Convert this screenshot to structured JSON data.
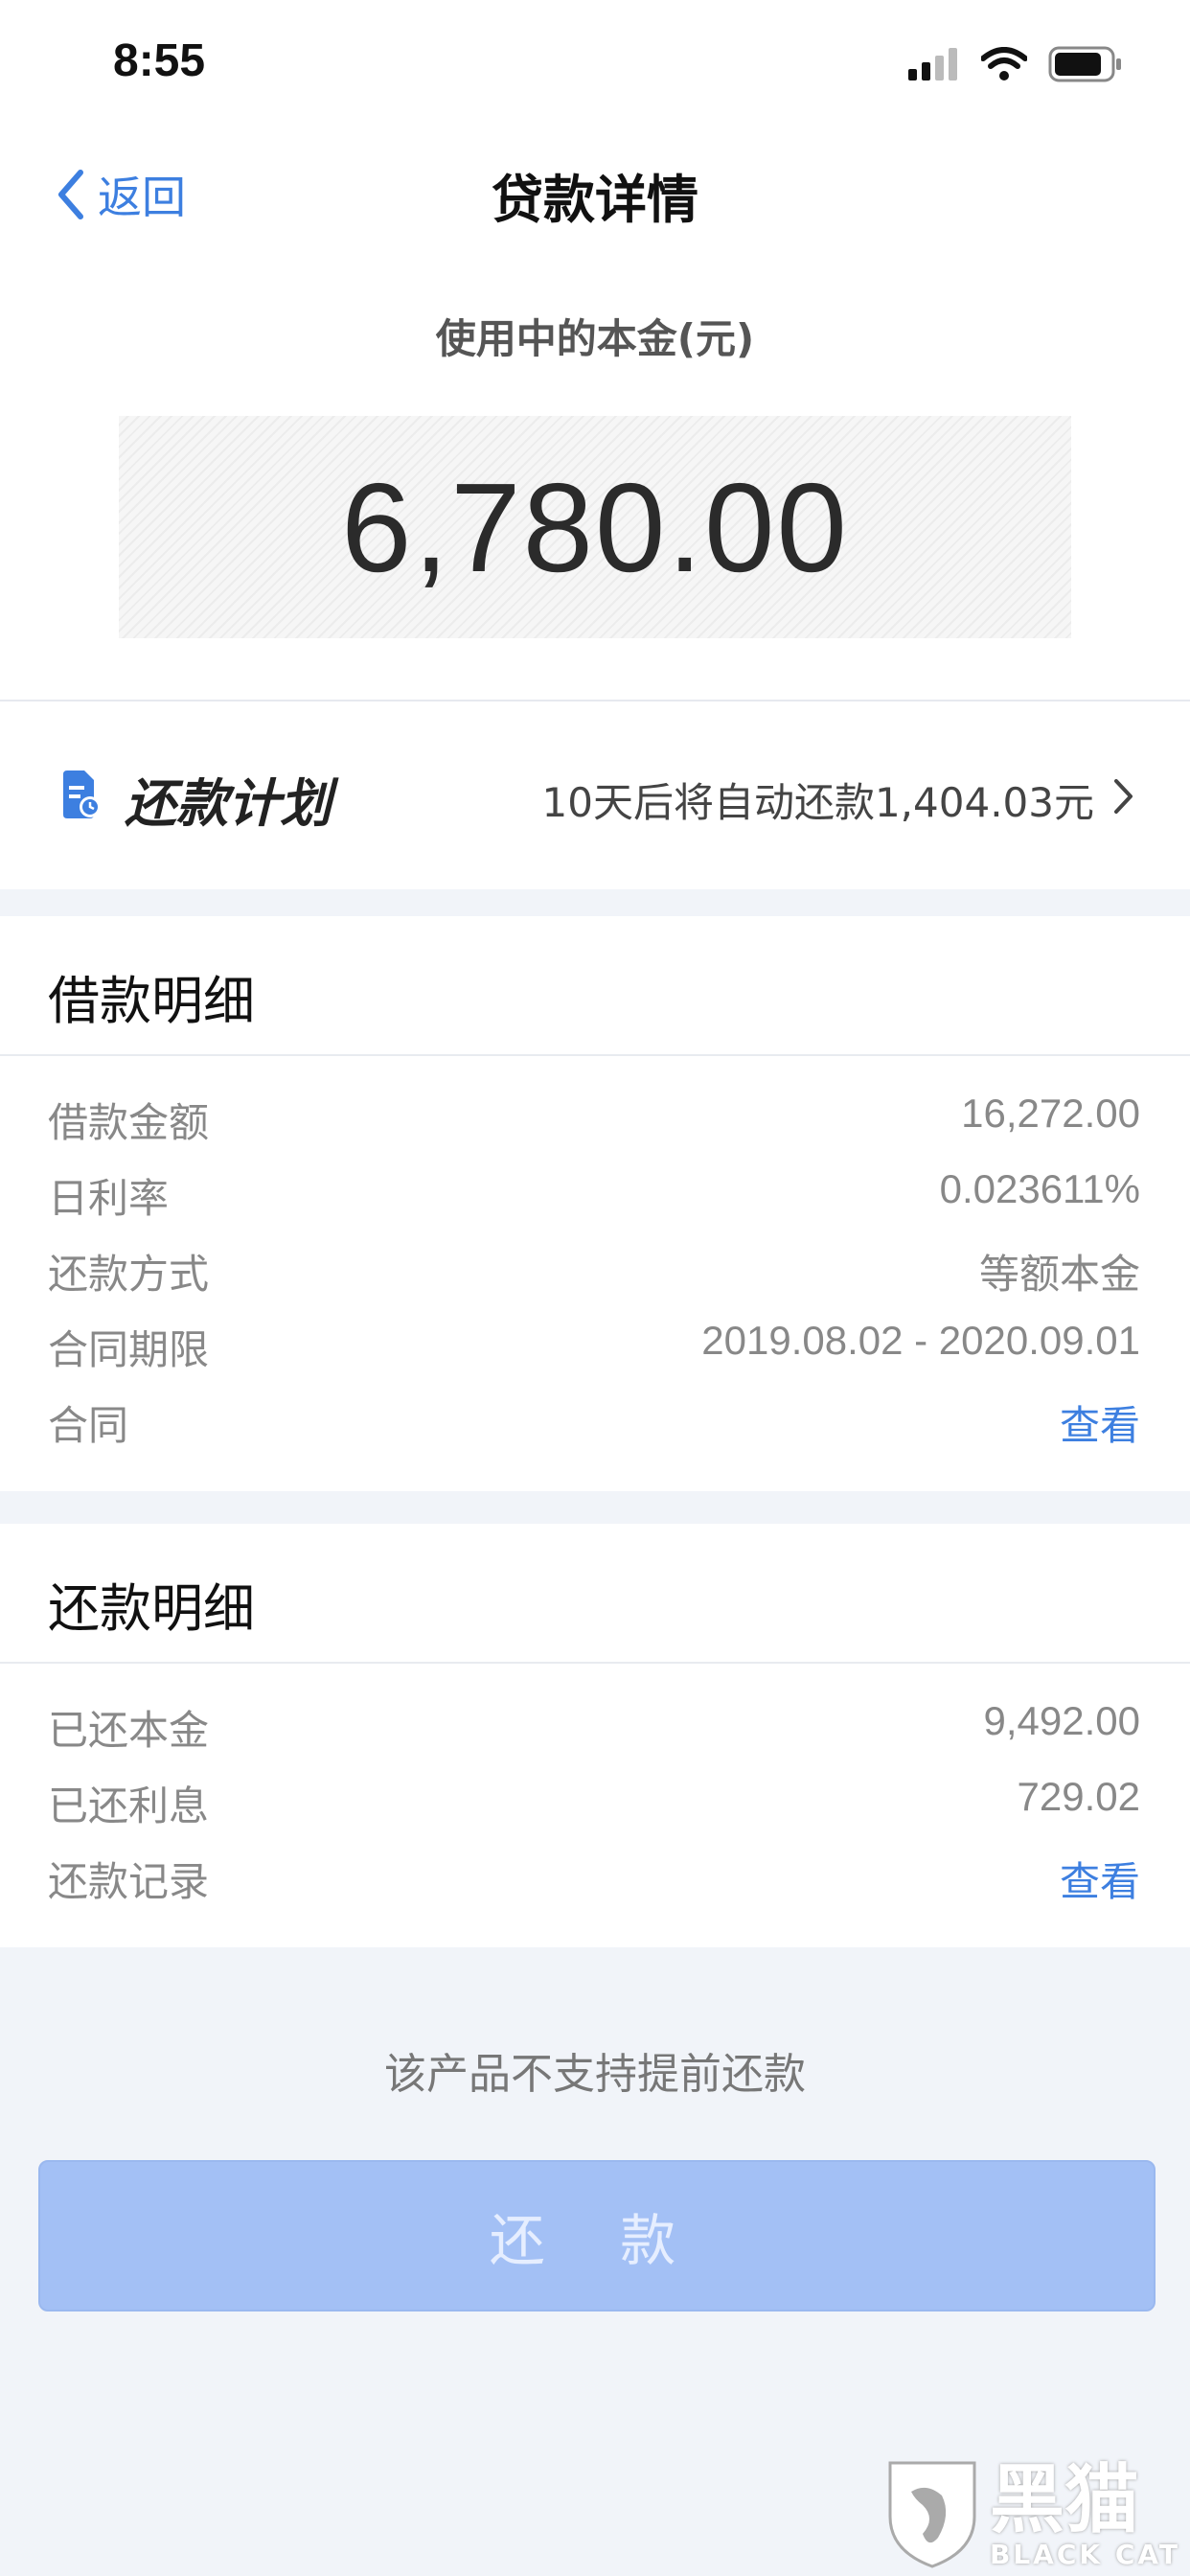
{
  "status_bar": {
    "time": "8:55"
  },
  "nav": {
    "back_label": "返回",
    "title": "贷款详情"
  },
  "hero": {
    "label": "使用中的本金(元)",
    "amount": "6,780.00"
  },
  "repayment_plan": {
    "title": "还款计划",
    "info": "10天后将自动还款1,404.03元"
  },
  "loan_detail": {
    "title": "借款明细",
    "rows": [
      {
        "label": "借款金额",
        "value": "16,272.00"
      },
      {
        "label": "日利率",
        "value": "0.023611%"
      },
      {
        "label": "还款方式",
        "value": "等额本金"
      },
      {
        "label": "合同期限",
        "value": "2019.08.02 - 2020.09.01"
      },
      {
        "label": "合同",
        "value": "查看"
      }
    ]
  },
  "repay_detail": {
    "title": "还款明细",
    "rows": [
      {
        "label": "已还本金",
        "value": "9,492.00"
      },
      {
        "label": "已还利息",
        "value": "729.02"
      },
      {
        "label": "还款记录",
        "value": "查看"
      }
    ]
  },
  "notice": "该产品不支持提前还款",
  "repay_button": "还 款",
  "watermark": {
    "cn": "黑猫",
    "en": "BLACK CAT"
  },
  "colors": {
    "accent": "#3d7fe0",
    "button_disabled": "#a3c0f5",
    "background": "#f1f4f9"
  },
  "icons": [
    "signal-icon",
    "wifi-icon",
    "battery-icon",
    "back-chevron-icon",
    "document-clock-icon",
    "chevron-right-icon",
    "cat-shield-icon"
  ]
}
